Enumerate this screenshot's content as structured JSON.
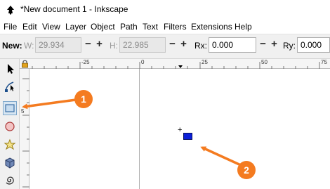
{
  "window": {
    "title": "*New document 1 - Inkscape"
  },
  "menu": [
    "File",
    "Edit",
    "View",
    "Layer",
    "Object",
    "Path",
    "Text",
    "Filters",
    "Extensions",
    "Help"
  ],
  "toolbar": {
    "new_label": "New:",
    "w_label": "W:",
    "w_value": "29.934",
    "h_label": "H:",
    "h_value": "22.985",
    "rx_label": "Rx:",
    "rx_value": "0.000",
    "ry_label": "Ry:",
    "ry_value": "0.000",
    "minus": "−",
    "plus": "+"
  },
  "ruler": {
    "h_labels": [
      "-25",
      "0",
      "25",
      "50",
      "75"
    ],
    "v_labels": [
      "5"
    ]
  },
  "canvas": {
    "crosshair": "+",
    "rect_color": "#0b1fd9"
  },
  "callouts": [
    "1",
    "2"
  ],
  "colors": {
    "accent": "#f47b20",
    "active_tool_bg": "#d8e6f2"
  }
}
